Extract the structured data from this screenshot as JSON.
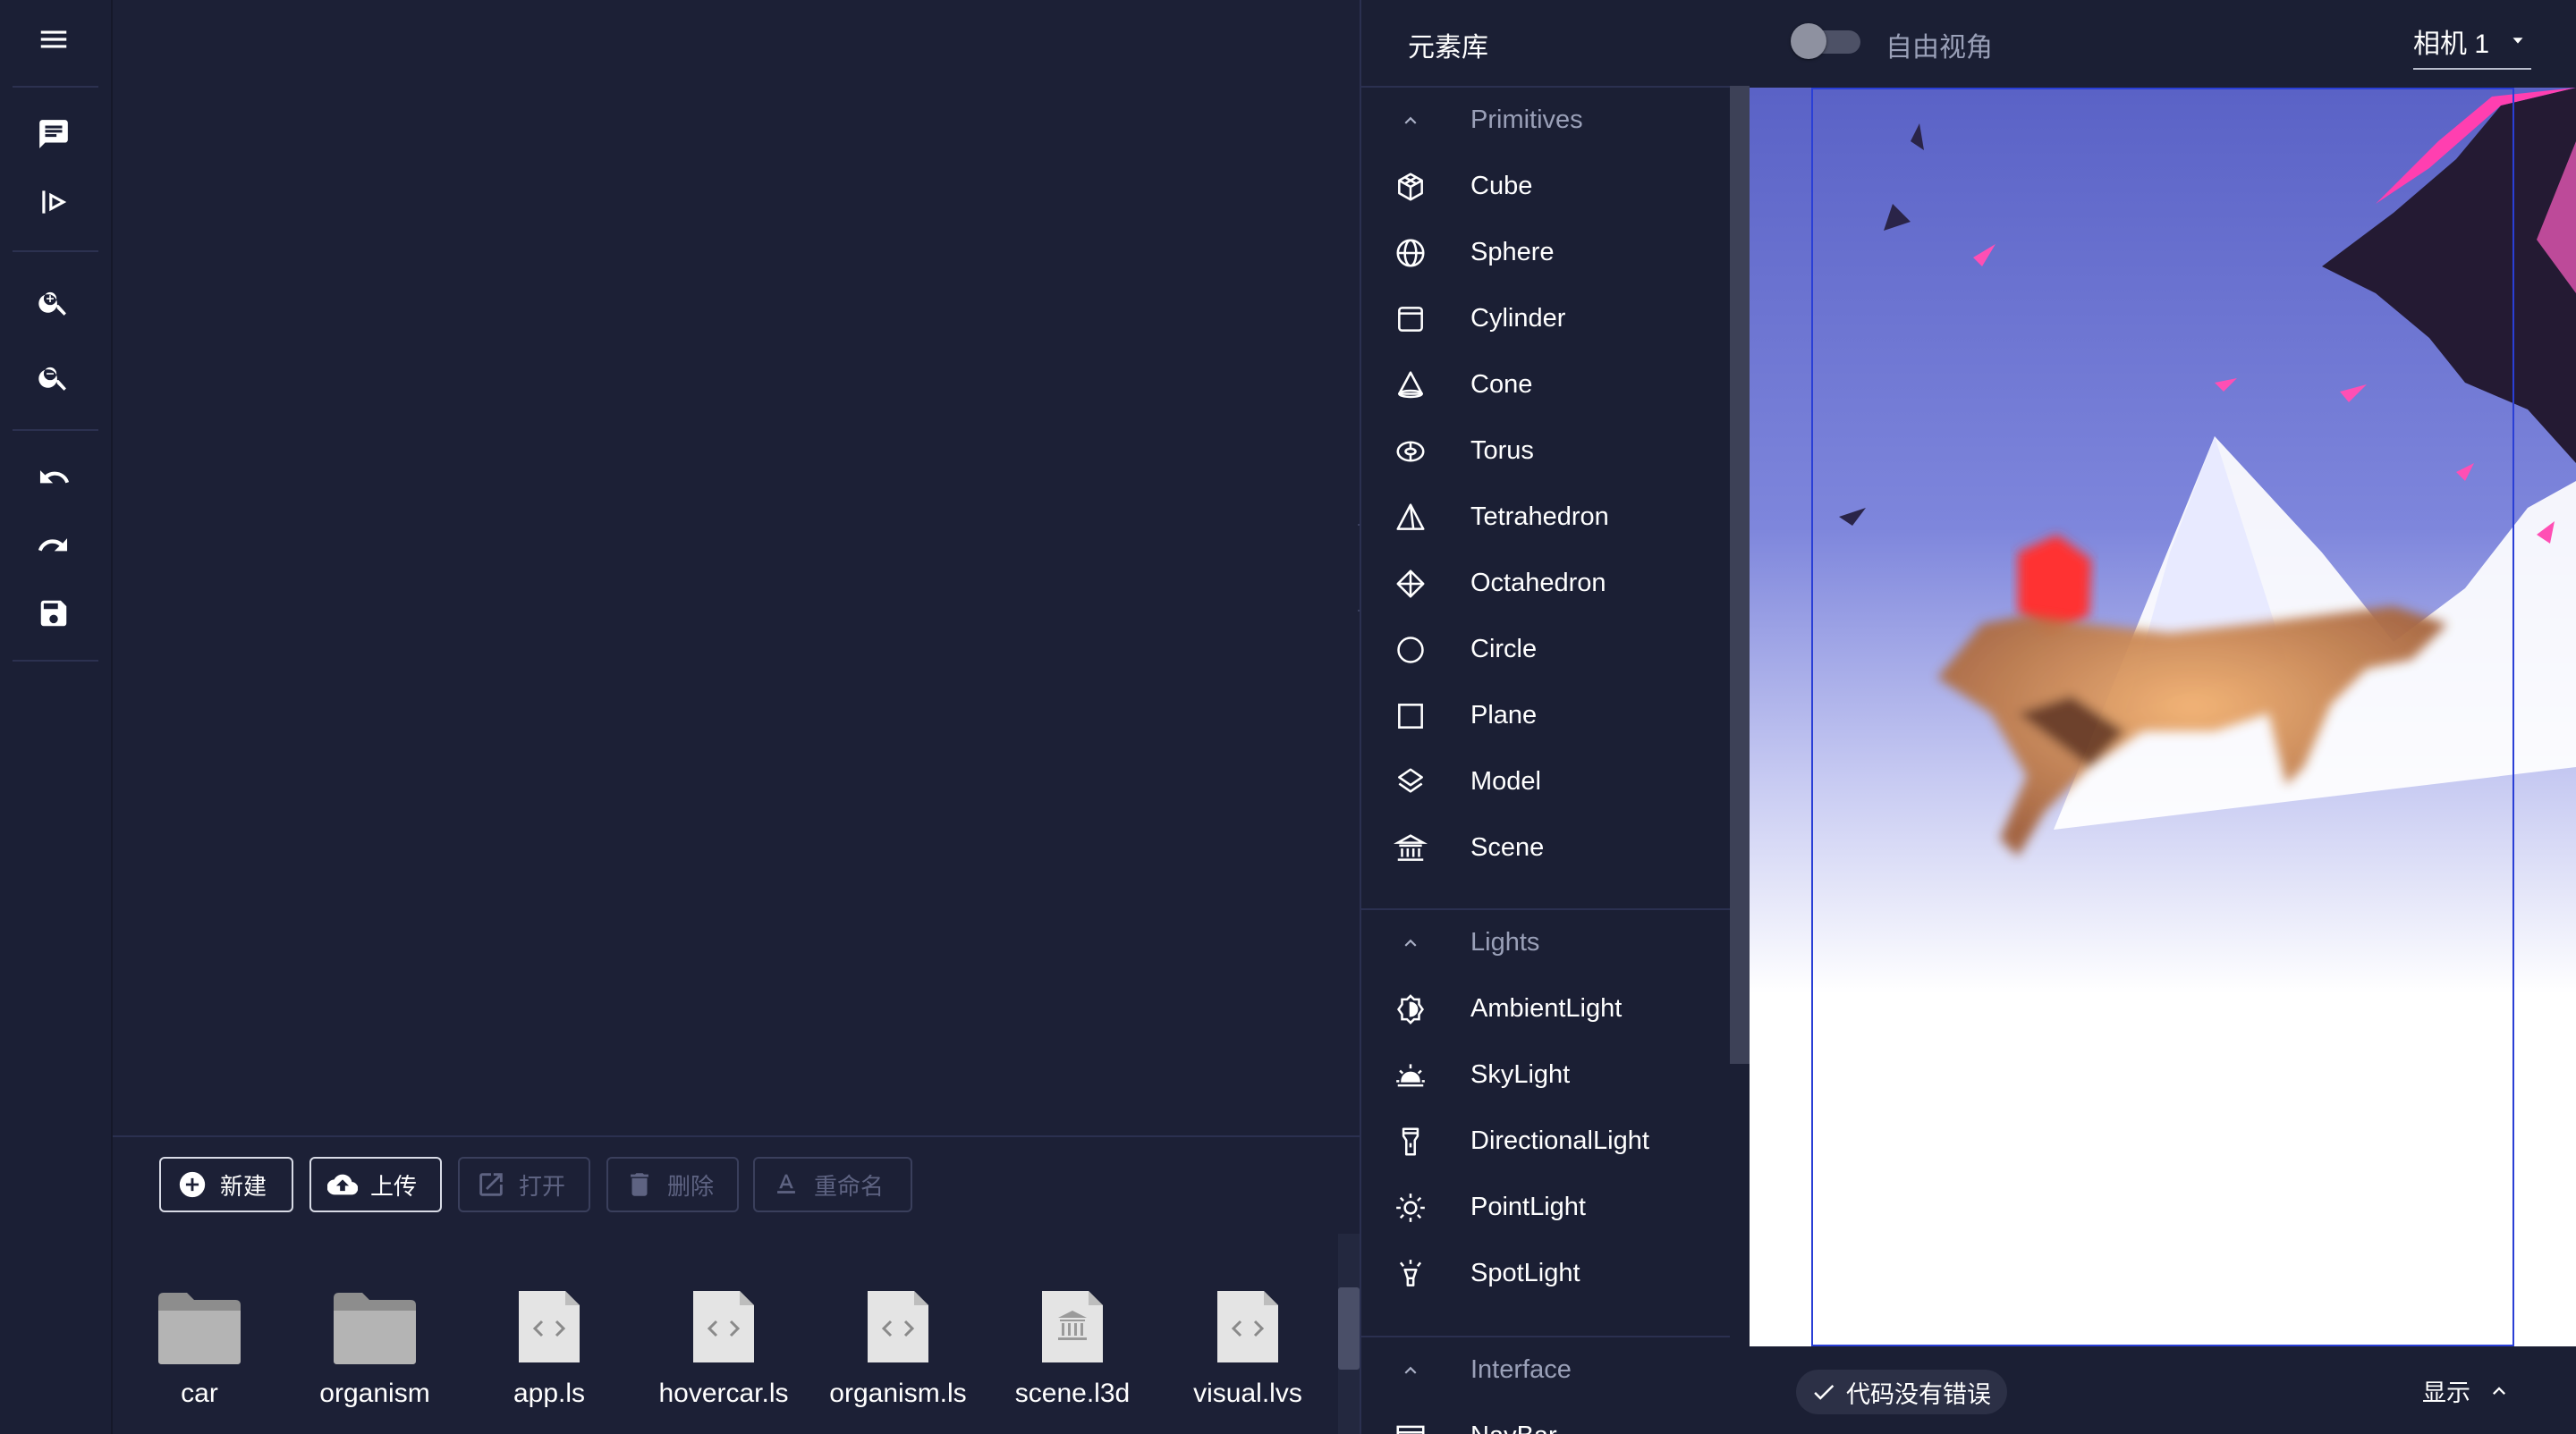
{
  "colors": {
    "background": "#1c2036",
    "panel": "#1b1f34",
    "text": "#ffffff",
    "muted": "#9aa0b8",
    "viewport_border": "#2a3fd6",
    "accent_red": "#ff3a3a",
    "accent_pink": "#ff4fb4"
  },
  "toolbar": {
    "icons": [
      "menu-icon",
      "comment-icon",
      "run-icon",
      "zoom-in-icon",
      "zoom-out-icon",
      "undo-icon",
      "redo-icon",
      "save-icon"
    ]
  },
  "file_panel": {
    "buttons": [
      {
        "label": "新建",
        "icon": "add-circle-icon",
        "enabled": true
      },
      {
        "label": "上传",
        "icon": "cloud-upload-icon",
        "enabled": true
      },
      {
        "label": "打开",
        "icon": "open-external-icon",
        "enabled": false
      },
      {
        "label": "删除",
        "icon": "trash-icon",
        "enabled": false
      },
      {
        "label": "重命名",
        "icon": "rename-icon",
        "enabled": false
      }
    ],
    "files": [
      {
        "name": "car",
        "type": "folder"
      },
      {
        "name": "organism",
        "type": "folder"
      },
      {
        "name": "app.ls",
        "type": "code"
      },
      {
        "name": "hovercar.ls",
        "type": "code"
      },
      {
        "name": "organism.ls",
        "type": "code"
      },
      {
        "name": "scene.l3d",
        "type": "scene"
      },
      {
        "name": "visual.lvs",
        "type": "code"
      }
    ]
  },
  "library": {
    "title": "元素库",
    "sections": [
      {
        "label": "Primitives",
        "items": [
          {
            "label": "Cube",
            "icon": "cube-icon"
          },
          {
            "label": "Sphere",
            "icon": "sphere-icon"
          },
          {
            "label": "Cylinder",
            "icon": "cylinder-icon"
          },
          {
            "label": "Cone",
            "icon": "cone-icon"
          },
          {
            "label": "Torus",
            "icon": "torus-icon"
          },
          {
            "label": "Tetrahedron",
            "icon": "tetrahedron-icon"
          },
          {
            "label": "Octahedron",
            "icon": "octahedron-icon"
          },
          {
            "label": "Circle",
            "icon": "circle-icon"
          },
          {
            "label": "Plane",
            "icon": "plane-icon"
          },
          {
            "label": "Model",
            "icon": "model-icon"
          },
          {
            "label": "Scene",
            "icon": "scene-icon"
          }
        ]
      },
      {
        "label": "Lights",
        "items": [
          {
            "label": "AmbientLight",
            "icon": "ambient-light-icon"
          },
          {
            "label": "SkyLight",
            "icon": "sky-light-icon"
          },
          {
            "label": "DirectionalLight",
            "icon": "directional-light-icon"
          },
          {
            "label": "PointLight",
            "icon": "point-light-icon"
          },
          {
            "label": "SpotLight",
            "icon": "spot-light-icon"
          }
        ]
      },
      {
        "label": "Interface",
        "items": [
          {
            "label": "NavBar",
            "icon": "navbar-icon"
          }
        ]
      }
    ]
  },
  "preview": {
    "free_view_label": "自由视角",
    "free_view_on": false,
    "camera": "相机 1",
    "status": "代码没有错误",
    "show_label": "显示"
  }
}
